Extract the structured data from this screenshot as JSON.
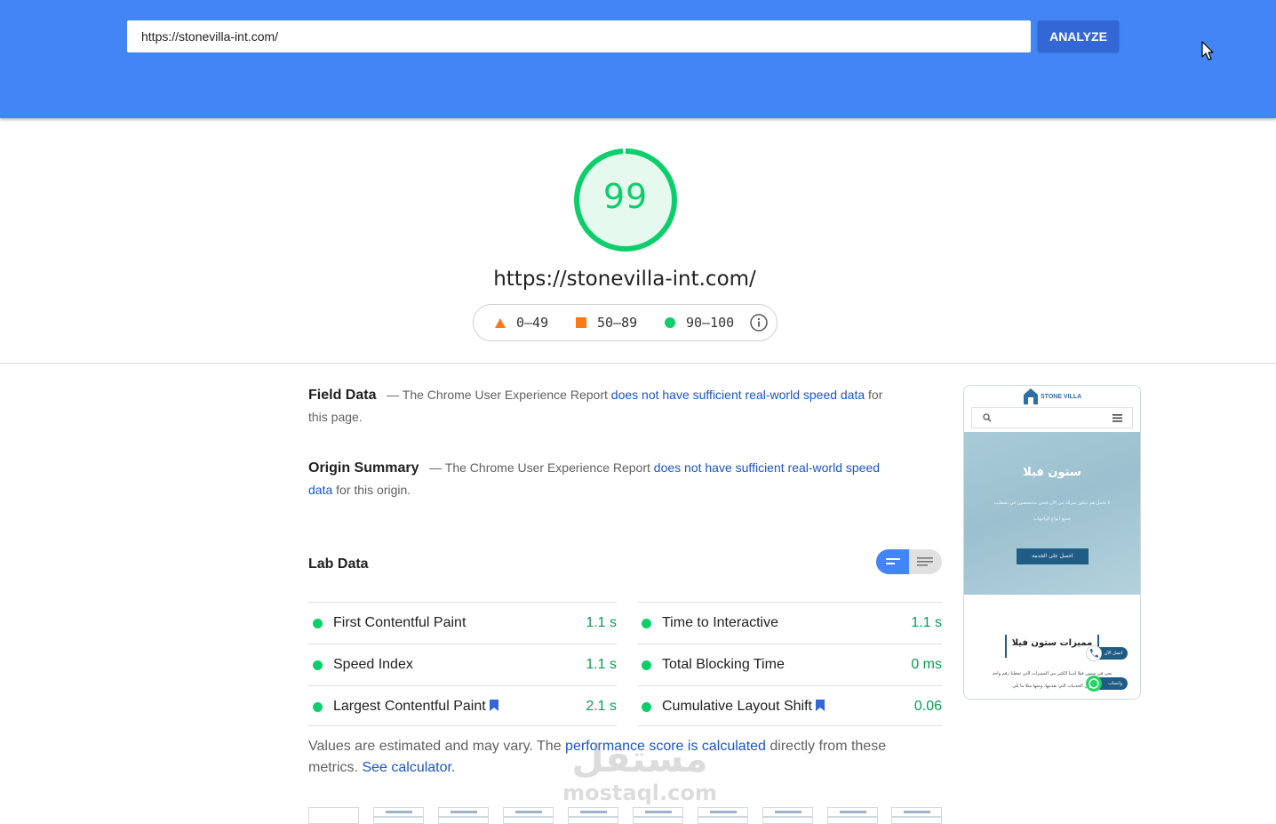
{
  "header": {
    "url_value": "https://stonevilla-int.com/",
    "analyze_label": "ANALYZE"
  },
  "score": {
    "value": "99",
    "fraction": 0.99,
    "color": "#0cce6b",
    "tested_url": "https://stonevilla-int.com/"
  },
  "legend": {
    "fail": "0–49",
    "average": "50–89",
    "pass": "90–100",
    "fail_color": "#ff4e42",
    "average_color": "#ffa400",
    "pass_color": "#0cce6b"
  },
  "field_data": {
    "heading": "Field Data",
    "dash": "—",
    "text_before": "The Chrome User Experience Report",
    "link": "does not have sufficient real-world speed data",
    "text_after": "for this page."
  },
  "origin_summary": {
    "heading": "Origin Summary",
    "dash": "—",
    "text_before": "The Chrome User Experience Report",
    "link": "does not have sufficient real-world speed data",
    "text_after": "for this origin."
  },
  "lab_data": {
    "heading": "Lab Data",
    "metrics_left": [
      {
        "name": "First Contentful Paint",
        "value": "1.1 s"
      },
      {
        "name": "Speed Index",
        "value": "1.1 s"
      },
      {
        "name": "Largest Contentful Paint",
        "value": "2.1 s"
      }
    ],
    "metrics_right": [
      {
        "name": "Time to Interactive",
        "value": "1.1 s"
      },
      {
        "name": "Total Blocking Time",
        "value": "0 ms"
      },
      {
        "name": "Cumulative Layout Shift",
        "value": "0.06"
      }
    ]
  },
  "note": {
    "text1": "Values are estimated and may vary. The",
    "link1": "performance score is calculated",
    "text2": "directly from these metrics.",
    "link2": "See calculator."
  },
  "screenshot": {
    "brand": "STONE VILLA",
    "hero_title": "ستون فيلا",
    "hero_sub1": "لا تحمل هم ديكور منزلك من الآن فنحن متخصصون في تشطيب",
    "hero_sub2": "جميع أنواع الواجهات",
    "hero_button": "احصل على الخدمة",
    "section_title": "مميزات ستون فيلا",
    "section_line1": "نحن في ستون فيلا لدينا الكثير من المميزات التي تجعلنا رقم واحد",
    "section_line2": "في الخدمات التي نقدمها، ومنها مثلا ما يلي:",
    "call_label": "اتصل الآن",
    "whatsapp_label": "واتساب"
  },
  "watermark": {
    "arabic": "مستقل",
    "latin": "mostaql.com"
  }
}
